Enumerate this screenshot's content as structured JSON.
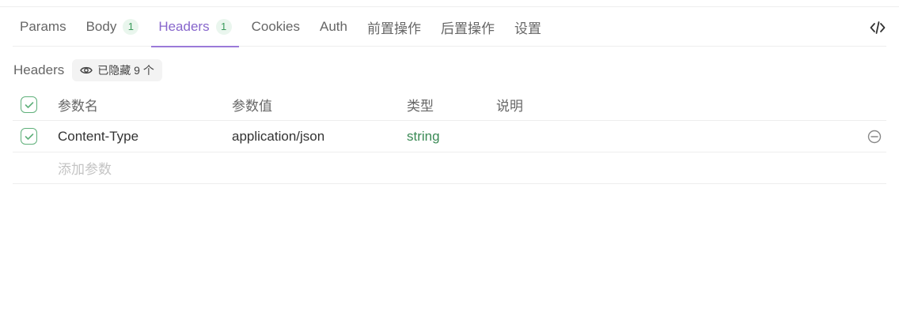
{
  "tabs": [
    {
      "label": "Params",
      "badge": null,
      "active": false
    },
    {
      "label": "Body",
      "badge": "1",
      "active": false
    },
    {
      "label": "Headers",
      "badge": "1",
      "active": true
    },
    {
      "label": "Cookies",
      "badge": null,
      "active": false
    },
    {
      "label": "Auth",
      "badge": null,
      "active": false
    },
    {
      "label": "前置操作",
      "badge": null,
      "active": false
    },
    {
      "label": "后置操作",
      "badge": null,
      "active": false
    },
    {
      "label": "设置",
      "badge": null,
      "active": false
    }
  ],
  "code_icon": "code-icon",
  "section": {
    "title": "Headers",
    "hidden_chip": "已隐藏 9 个",
    "hidden_icon": "eye-icon"
  },
  "table": {
    "columns": {
      "name": "参数名",
      "value": "参数值",
      "type": "类型",
      "desc": "说明"
    },
    "rows": [
      {
        "name": "Content-Type",
        "value": "application/json",
        "type": "string",
        "desc": "",
        "checked": true
      }
    ],
    "add_placeholder": "添加参数"
  },
  "colors": {
    "accent": "#8766cc",
    "check": "#5fb07a",
    "type": "#3a8a55"
  }
}
